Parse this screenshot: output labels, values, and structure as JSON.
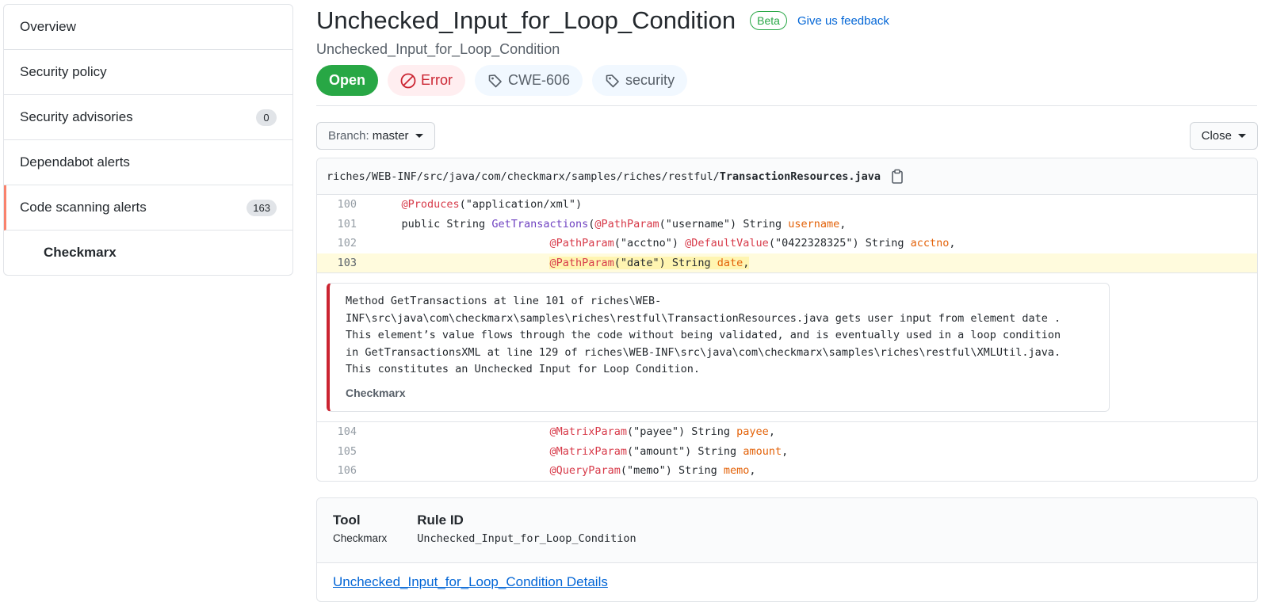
{
  "sidebar": {
    "items": [
      {
        "label": "Overview"
      },
      {
        "label": "Security policy"
      },
      {
        "label": "Security advisories",
        "count": "0"
      },
      {
        "label": "Dependabot alerts"
      },
      {
        "label": "Code scanning alerts",
        "count": "163"
      },
      {
        "label": "Checkmarx"
      }
    ]
  },
  "alert": {
    "title": "Unchecked_Input_for_Loop_Condition",
    "beta": "Beta",
    "feedback": "Give us feedback",
    "subtitle": "Unchecked_Input_for_Loop_Condition",
    "status": "Open",
    "severity": "Error",
    "tags": [
      "CWE-606",
      "security"
    ]
  },
  "toolbar": {
    "branch_prefix": "Branch:",
    "branch": "master",
    "close_label": "Close"
  },
  "code": {
    "path_prefix": "riches/WEB-INF/src/java/com/checkmarx/samples/riches/restful/",
    "file_name": "TransactionResources.java",
    "lines_before": [
      {
        "num": "100",
        "parts": [
          [
            "ann",
            "@Produces"
          ],
          [
            "str",
            "(\"application/xml\")"
          ]
        ],
        "indent": "    "
      },
      {
        "num": "101",
        "parts": [
          [
            "str",
            "public String "
          ],
          [
            "fn",
            "GetTransactions"
          ],
          [
            "str",
            "("
          ],
          [
            "ann",
            "@PathParam"
          ],
          [
            "str",
            "(\"username\") String "
          ],
          [
            "var",
            "username"
          ],
          [
            "str",
            ","
          ]
        ],
        "indent": "    "
      },
      {
        "num": "102",
        "parts": [
          [
            "ann",
            "@PathParam"
          ],
          [
            "str",
            "(\"acctno\") "
          ],
          [
            "ann",
            "@DefaultValue"
          ],
          [
            "str",
            "(\"0422328325\") String "
          ],
          [
            "var",
            "acctno"
          ],
          [
            "str",
            ","
          ]
        ],
        "indent": "                           "
      },
      {
        "num": "103",
        "parts": [
          [
            "ann",
            "@PathParam"
          ],
          [
            "str",
            "(\"date\") String "
          ],
          [
            "var",
            "date"
          ],
          [
            "str",
            ","
          ]
        ],
        "indent": "                           "
      }
    ],
    "lines_after": [
      {
        "num": "104",
        "parts": [
          [
            "ann",
            "@MatrixParam"
          ],
          [
            "str",
            "(\"payee\") String "
          ],
          [
            "var",
            "payee"
          ],
          [
            "str",
            ","
          ]
        ],
        "indent": "                           "
      },
      {
        "num": "105",
        "parts": [
          [
            "ann",
            "@MatrixParam"
          ],
          [
            "str",
            "(\"amount\") String "
          ],
          [
            "var",
            "amount"
          ],
          [
            "str",
            ","
          ]
        ],
        "indent": "                           "
      },
      {
        "num": "106",
        "parts": [
          [
            "ann",
            "@QueryParam"
          ],
          [
            "str",
            "(\"memo\") String "
          ],
          [
            "var",
            "memo"
          ],
          [
            "str",
            ","
          ]
        ],
        "indent": "                           "
      }
    ],
    "message_lines": [
      "Method GetTransactions at line 101 of riches\\WEB-",
      "INF\\src\\java\\com\\checkmarx\\samples\\riches\\restful\\TransactionResources.java gets user input from element date .",
      "This element’s value flows through the code without being validated, and is eventually used in a loop condition",
      "in GetTransactionsXML at line 129 of riches\\WEB-INF\\src\\java\\com\\checkmarx\\samples\\riches\\restful\\XMLUtil.java.",
      "This constitutes an Unchecked Input for Loop Condition."
    ],
    "message_tool": "Checkmarx"
  },
  "info": {
    "tool_header": "Tool",
    "tool_value": "Checkmarx",
    "rule_header": "Rule ID",
    "rule_value": "Unchecked_Input_for_Loop_Condition",
    "details_link": "Unchecked_Input_for_Loop_Condition Details"
  },
  "colors": {
    "open": "#28a745",
    "error": "#cb2431",
    "link": "#0366d6",
    "highlight": "#fffbdd",
    "selected_border": "#f9826c"
  }
}
